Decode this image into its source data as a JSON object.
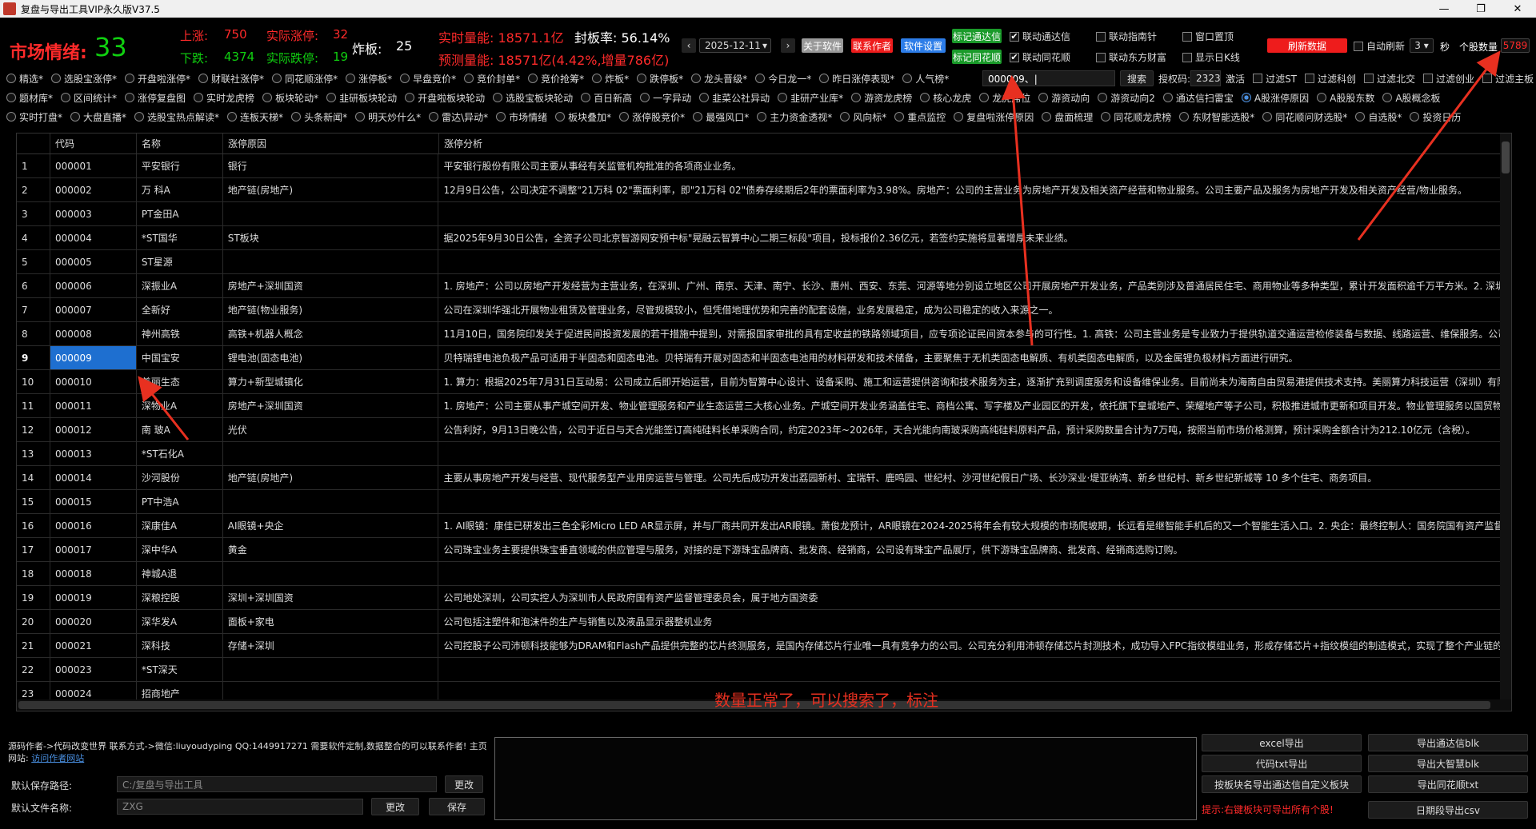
{
  "window": {
    "title": "复盘与导出工具VIP永久版V37.5",
    "controls": [
      "—",
      "❐",
      "✕"
    ]
  },
  "stats": {
    "mood_label": "市场情绪:",
    "mood_value": "33",
    "up_label": "上涨:",
    "up_value": "750",
    "down_label": "下跌:",
    "down_value": "4374",
    "limit_up_label": "实际涨停:",
    "limit_up_value": "32",
    "limit_down_label": "实际跌停:",
    "limit_down_value": "19",
    "broken_label": "炸板:",
    "broken_value": "25",
    "actual_volume": "实时量能: 18571.1亿",
    "seal_rate": "封板率: 56.14%",
    "predicted_volume": "预测量能: 18571亿(4.42%,增量786亿)",
    "date": "2025-12-11",
    "stock_count_label": "个股数量",
    "stock_count": "5789",
    "auto_refresh_label": "自动刷新",
    "refresh_interval": "3",
    "refresh_unit": "秒"
  },
  "buttons": {
    "about": "关于软件",
    "contact": "联系作者",
    "settings": "软件设置",
    "mark_tdx": "标记通达信",
    "mark_ths": "标记同花顺",
    "refresh": "刷新数据",
    "search": "搜索"
  },
  "toggles": {
    "link_tdx": "联动通达信",
    "link_ths": "联动同花顺",
    "link_znz": "联动指南针",
    "link_dfcf": "联动东方财富",
    "window_top": "窗口置顶",
    "show_kline": "显示日K线"
  },
  "filter_row1": [
    "精选*",
    "选股宝涨停*",
    "开盘啦涨停*",
    "财联社涨停*",
    "同花顺涨停*",
    "涨停板*",
    "早盘竞价*",
    "竞价封单*",
    "竞价抢筹*",
    "炸板*",
    "跌停板*",
    "龙头晋级*",
    "今日龙一*",
    "昨日涨停表现*",
    "人气榜*"
  ],
  "filter_row1_right": {
    "search_value": "000009、|",
    "auth_label": "授权码:",
    "auth_value": "2323",
    "activate": "激活",
    "items": [
      "过滤ST",
      "过滤科创",
      "过滤北交",
      "过滤创业",
      "过滤主板"
    ]
  },
  "filter_row2": [
    "题材库*",
    "区间统计*",
    "涨停复盘图",
    "实时龙虎榜",
    "板块轮动*",
    "韭研板块轮动",
    "开盘啦板块轮动",
    "选股宝板块轮动",
    "百日新高",
    "一字异动",
    "韭菜公社异动",
    "韭研产业库*",
    "游资龙虎榜",
    "核心龙虎",
    "龙虎席位",
    "游资动向",
    "游资动向2",
    "通达信扫雷宝",
    "A股涨停原因",
    "A股股东数",
    "A股概念板"
  ],
  "filter_row3": [
    "实时打盘*",
    "大盘直播*",
    "选股宝热点解读*",
    "连板天梯*",
    "头条新闻*",
    "明天炒什么*",
    "雷达\\异动*",
    "市场情绪",
    "板块叠加*",
    "涨停股竞价*",
    "最强风口*",
    "主力资金透视*",
    "风向标*",
    "重点监控",
    "复盘啦涨停原因",
    "盘面梳理",
    "同花顺龙虎榜",
    "东财智能选股*",
    "同花顺问财选股*",
    "自选股*",
    "投资日历"
  ],
  "table": {
    "columns": [
      "",
      "代码",
      "名称",
      "涨停原因",
      "涨停分析"
    ],
    "rows": [
      [
        "1",
        "000001",
        "平安银行",
        "银行",
        "平安银行股份有限公司主要从事经有关监管机构批准的各项商业业务。"
      ],
      [
        "2",
        "000002",
        "万 科A",
        "地产链(房地产)",
        "12月9日公告，公司决定不调整\"21万科 02\"票面利率，即\"21万科 02\"债券存续期后2年的票面利率为3.98%。房地产：公司的主营业务为房地产开发及相关资产经营和物业服务。公司主要产品及服务为房地产开发及相关资产经营/物业服务。"
      ],
      [
        "3",
        "000003",
        "PT金田A",
        "",
        ""
      ],
      [
        "4",
        "000004",
        "*ST国华",
        "ST板块",
        "据2025年9月30日公告，全资子公司北京智游网安预中标\"晃融云智算中心二期三标段\"项目，投标报价2.36亿元，若签约实施将显著增厚未来业绩。"
      ],
      [
        "5",
        "000005",
        "ST星源",
        "",
        ""
      ],
      [
        "6",
        "000006",
        "深振业A",
        "房地产+深圳国资",
        "1. 房地产：公司以房地产开发经营为主营业务，在深圳、广州、南京、天津、南宁、长沙、惠州、西安、东莞、河源等地分别设立地区公司开展房地产开发业务，产品类别涉及普通居民住宅、商用物业等多种类型，累计开发面积逾千万平方米。2. 深圳国"
      ],
      [
        "7",
        "000007",
        "全新好",
        "地产链(物业服务)",
        "公司在深圳华强北开展物业租赁及管理业务，尽管规模较小，但凭借地理优势和完善的配套设施，业务发展稳定，成为公司稳定的收入来源之一。"
      ],
      [
        "8",
        "000008",
        "神州高铁",
        "高铁+机器人概念",
        "11月10日，国务院印发关于促进民间投资发展的若干措施中提到，对需报国家审批的具有定收益的铁路领域项目，应专项论证民间资本参与的可行性。1. 高铁：公司主营业务是专业致力于提供轨道交通运营检修装备与数据、线路运营、维保服务。公司业务"
      ],
      [
        "9",
        "000009",
        "中国宝安",
        "锂电池(固态电池)",
        "贝特瑞锂电池负极产品可适用于半固态和固态电池。贝特瑞有开展对固态和半固态电池用的材料研发和技术储备，主要聚焦于无机类固态电解质、有机类固态电解质，以及金属锂负极材料方面进行研究。"
      ],
      [
        "10",
        "000010",
        "美丽生态",
        "算力+新型城镇化",
        "1. 算力：根据2025年7月31日互动易：公司成立后即开始运营，目前为智算中心设计、设备采购、施工和运营提供咨询和技术服务为主，逐渐扩充到调度服务和设备维保业务。目前尚未为海南自由贸易港提供技术支持。美丽算力科技运营（深圳）有限公司"
      ],
      [
        "11",
        "000011",
        "深物业A",
        "房地产+深圳国资",
        "1. 房地产：公司主要从事产城空间开发、物业管理服务和产业生态运营三大核心业务。产城空间开发业务涵盖住宅、商档公寓、写字楼及产业园区的开发，依托旗下皇城地产、荣耀地产等子公司，积极推进城市更新和项目开发。物业管理服务以国贸物业"
      ],
      [
        "12",
        "000012",
        "南 玻A",
        "光伏",
        "公告利好，9月13日晚公告，公司于近日与天合光能签订高纯硅料长单采购合同，约定2023年~2026年，天合光能向南玻采购高纯硅料原料产品，预计采购数量合计为7万吨，按照当前市场价格测算，预计采购金额合计为212.10亿元（含税）。"
      ],
      [
        "13",
        "000013",
        "*ST石化A",
        "",
        ""
      ],
      [
        "14",
        "000014",
        "沙河股份",
        "地产链(房地产)",
        "主要从事房地产开发与经营、现代服务型产业用房运营与管理。公司先后成功开发出荔园新村、宝瑞轩、鹿鸣园、世纪村、沙河世纪假日广场、长沙深业·堤亚纳湾、新乡世纪村、新乡世纪新城等 10 多个住宅、商务项目。"
      ],
      [
        "15",
        "000015",
        "PT中浩A",
        "",
        ""
      ],
      [
        "16",
        "000016",
        "深康佳A",
        "AI眼镜+央企",
        "1. AI眼镜：康佳已研发出三色全彩Micro LED AR显示屏，并与厂商共同开发出AR眼镜。萧俊龙预计，AR眼镜在2024-2025将年会有较大规模的市场爬坡期，长远看是继智能手机后的又一个智能生活入口。2. 央企：最终控制人：国务院国有资产监督管理"
      ],
      [
        "17",
        "000017",
        "深中华A",
        "黄金",
        "公司珠宝业务主要提供珠宝垂直领域的供应管理与服务，对接的是下游珠宝品牌商、批发商、经销商，公司设有珠宝产品展厅，供下游珠宝品牌商、批发商、经销商选购订购。"
      ],
      [
        "18",
        "000018",
        "神城A退",
        "",
        ""
      ],
      [
        "19",
        "000019",
        "深粮控股",
        "深圳+深圳国资",
        "公司地处深圳，公司实控人为深圳市人民政府国有资产监督管理委员会，属于地方国资委"
      ],
      [
        "20",
        "000020",
        "深华发A",
        "面板+家电",
        "公司包括注塑件和泡沫件的生产与销售以及液晶显示器整机业务"
      ],
      [
        "21",
        "000021",
        "深科技",
        "存储+深圳",
        "公司控股子公司沛顿科技能够为DRAM和Flash产品提供完整的芯片终测服务，是国内存储芯片行业唯一具有竞争力的公司。公司充分利用沛顿存储芯片封测技术，成功导入FPC指纹模组业务，形成存储芯片+指纹模组的制造模式，实现了整个产业链的延伸"
      ],
      [
        "22",
        "000023",
        "*ST深天",
        "",
        ""
      ],
      [
        "23",
        "000024",
        "招商地产",
        "",
        ""
      ]
    ],
    "selected_row": 9
  },
  "annotation_note": "数量正常了，可以搜索了，标注",
  "bottom": {
    "author_text": "源码作者->代码改变世界 联系方式->微信:liuyoudyping QQ:1449917271 需要软件定制,数据整合的可以联系作者! 主页网站:",
    "author_link": "访问作者网站",
    "save_path_label": "默认保存路径:",
    "save_path_value": "C:/复盘与导出工具",
    "change_btn": "更改",
    "file_name_label": "默认文件名称:",
    "file_name_value": "ZXG",
    "change_btn2": "更改",
    "save_btn": "保存",
    "export_buttons_left": [
      "excel导出",
      "代码txt导出",
      "按板块名导出通达信自定义板块"
    ],
    "export_buttons_right": [
      "导出通达信blk",
      "导出大智慧blk",
      "导出同花顺txt",
      "日期段导出csv"
    ],
    "hint": "提示:右键板块可导出所有个股!"
  },
  "colors": {
    "accent_red": "#ff2a2a",
    "accent_green": "#10d010",
    "selection_blue": "#1e6fd0",
    "arrow_red": "#e83020"
  }
}
